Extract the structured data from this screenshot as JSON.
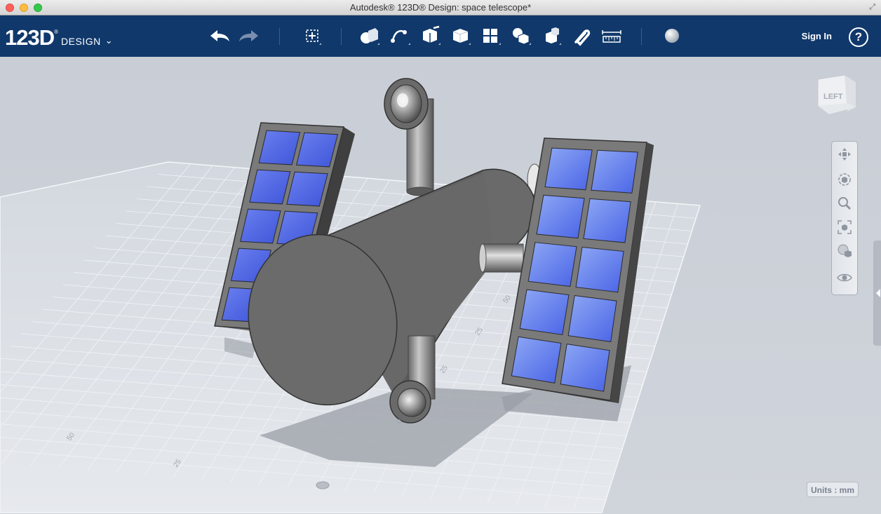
{
  "window": {
    "title": "Autodesk® 123D® Design: space telescope*"
  },
  "app": {
    "logo_main": "123D",
    "logo_reg": "®",
    "logo_sub": "DESIGN",
    "logo_chevron": "ˇ"
  },
  "toolbar": {
    "tools": [
      "undo-icon",
      "redo-icon",
      "transform-icon",
      "primitives-icon",
      "sketch-icon",
      "construct-icon",
      "modify-icon",
      "pattern-icon",
      "grouping-icon",
      "combine-icon",
      "snap-icon",
      "measure-icon",
      "material-icon"
    ],
    "sign_in": "Sign In",
    "help": "?"
  },
  "viewcube": {
    "face": "LEFT"
  },
  "navbar": {
    "tools": [
      "pan-icon",
      "orbit-icon",
      "zoom-icon",
      "fit-icon",
      "materials-display-icon",
      "visibility-icon"
    ]
  },
  "grid": {
    "labels": [
      "50",
      "25",
      "0",
      "25",
      "25",
      "50"
    ]
  },
  "status": {
    "units": "Units : mm"
  },
  "colors": {
    "toolbar_bg": "#10386b",
    "panel_blue": "#4a64e6",
    "body_gray": "#707070"
  }
}
